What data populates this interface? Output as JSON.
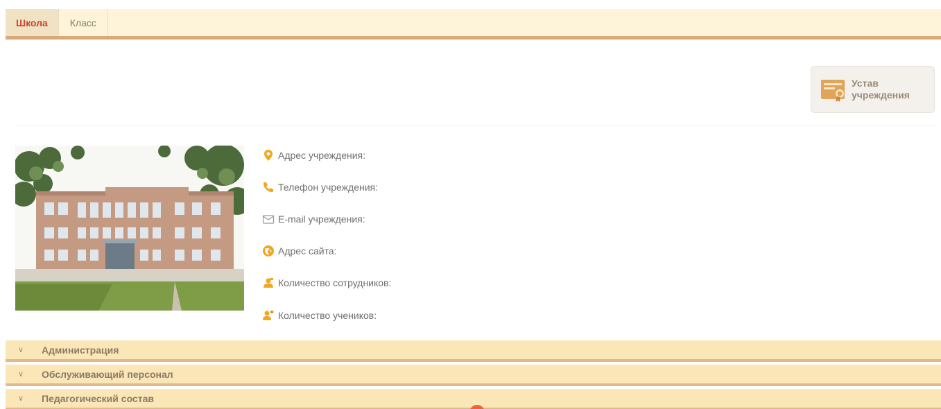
{
  "tabs": [
    {
      "label": "Школа",
      "active": true
    },
    {
      "label": "Класс",
      "active": false
    }
  ],
  "statute": {
    "label": "Устав\nучреждения",
    "icon": "certificate-icon"
  },
  "school_photo": {
    "icon": "school-building-photo"
  },
  "info": [
    {
      "label": "Адрес учреждения:",
      "icon": "location-pin-icon"
    },
    {
      "label": "Телефон учреждения:",
      "icon": "phone-icon"
    },
    {
      "label": "E-mail учреждения:",
      "icon": "envelope-icon"
    },
    {
      "label": "Адрес сайта:",
      "icon": "globe-icon"
    },
    {
      "label": "Количество сотрудников:",
      "icon": "staff-icon"
    },
    {
      "label": "Количество учеников:",
      "icon": "students-icon"
    }
  ],
  "accordion": [
    {
      "title": "Администрация"
    },
    {
      "title": "Обслуживающий персонал"
    },
    {
      "title": "Педагогический состав"
    }
  ],
  "colors": {
    "accent": "#c8452d",
    "tab_bar": "#fdf4da",
    "accordion": "#fbe6b8",
    "border": "#d9a97a",
    "icon_orange": "#f0a81e"
  }
}
